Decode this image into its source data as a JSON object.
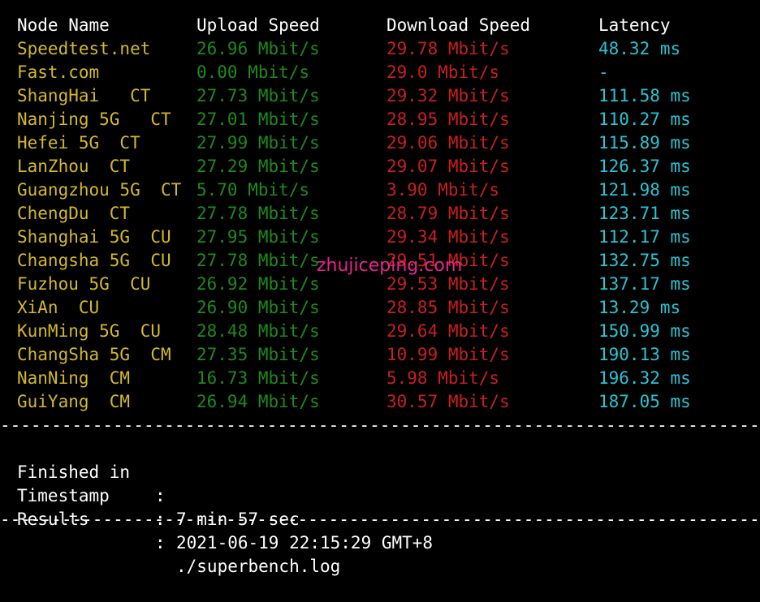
{
  "header": {
    "node_name": "Node Name",
    "upload_speed": "Upload Speed",
    "download_speed": "Download Speed",
    "latency": "Latency"
  },
  "rows": [
    {
      "name": "Speedtest.net",
      "upload": "26.96 Mbit/s",
      "download": "29.78 Mbit/s",
      "latency": "48.32 ms"
    },
    {
      "name": "Fast.com",
      "upload": "0.00 Mbit/s",
      "download": "29.0 Mbit/s",
      "latency": "-"
    },
    {
      "name": "ShangHai   CT",
      "upload": "27.73 Mbit/s",
      "download": "29.32 Mbit/s",
      "latency": "111.58 ms"
    },
    {
      "name": "Nanjing 5G   CT",
      "upload": "27.01 Mbit/s",
      "download": "28.95 Mbit/s",
      "latency": "110.27 ms"
    },
    {
      "name": "Hefei 5G  CT",
      "upload": "27.99 Mbit/s",
      "download": "29.06 Mbit/s",
      "latency": "115.89 ms"
    },
    {
      "name": "LanZhou  CT",
      "upload": "27.29 Mbit/s",
      "download": "29.07 Mbit/s",
      "latency": "126.37 ms"
    },
    {
      "name": "Guangzhou 5G  CT",
      "upload": "5.70 Mbit/s",
      "download": "3.90 Mbit/s",
      "latency": "121.98 ms"
    },
    {
      "name": "ChengDu  CT",
      "upload": "27.78 Mbit/s",
      "download": "28.79 Mbit/s",
      "latency": "123.71 ms"
    },
    {
      "name": "Shanghai 5G  CU",
      "upload": "27.95 Mbit/s",
      "download": "29.34 Mbit/s",
      "latency": "112.17 ms"
    },
    {
      "name": "Changsha 5G  CU",
      "upload": "27.78 Mbit/s",
      "download": "29.51 Mbit/s",
      "latency": "132.75 ms"
    },
    {
      "name": "Fuzhou 5G  CU",
      "upload": "26.92 Mbit/s",
      "download": "29.53 Mbit/s",
      "latency": "137.17 ms"
    },
    {
      "name": "XiAn  CU",
      "upload": "26.90 Mbit/s",
      "download": "28.85 Mbit/s",
      "latency": "13.29 ms"
    },
    {
      "name": "KunMing 5G  CU",
      "upload": "28.48 Mbit/s",
      "download": "29.64 Mbit/s",
      "latency": "150.99 ms"
    },
    {
      "name": "ChangSha 5G  CM",
      "upload": "27.35 Mbit/s",
      "download": "10.99 Mbit/s",
      "latency": "190.13 ms"
    },
    {
      "name": "NanNing  CM",
      "upload": "16.73 Mbit/s",
      "download": "5.98 Mbit/s",
      "latency": "196.32 ms"
    },
    {
      "name": "GuiYang  CM",
      "upload": "26.94 Mbit/s",
      "download": "30.57 Mbit/s",
      "latency": "187.05 ms"
    }
  ],
  "divider": "--------------------------------------------------------------------------------------------------",
  "summary": {
    "finished_label": "Finished in",
    "finished_value": "7 min 57 sec",
    "timestamp_label": "Timestamp",
    "timestamp_value": "2021-06-19 22:15:29 GMT+8",
    "results_label": "Results",
    "results_value": "./superbench.log",
    "separator": ":"
  },
  "watermark": "zhujiceping.com",
  "colors": {
    "background": "#000000",
    "node_name": "#d4b928",
    "upload": "#1e8a1e",
    "download": "#c8201e",
    "latency": "#28c4d4",
    "watermark": "#e8258c"
  }
}
